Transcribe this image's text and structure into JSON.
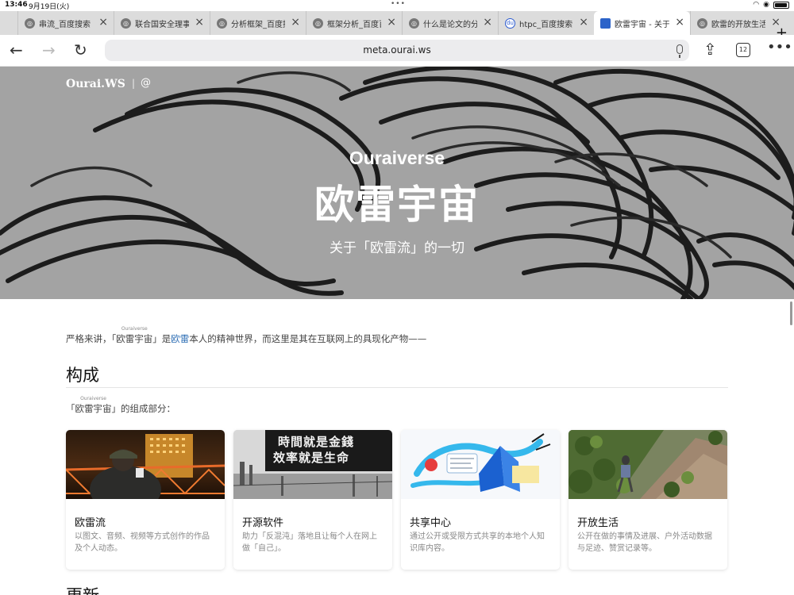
{
  "status": {
    "time": "13:46",
    "date": "9月19日(火)"
  },
  "tabs": [
    {
      "label": "串流_百度搜索",
      "icon": "globe-icon"
    },
    {
      "label": "联合国安全理事会",
      "icon": "globe-icon"
    },
    {
      "label": "分析框架_百度搜索",
      "icon": "globe-icon"
    },
    {
      "label": "框架分析_百度百科",
      "icon": "globe-icon"
    },
    {
      "label": "什么是论文的分析",
      "icon": "globe-icon"
    },
    {
      "label": "htpc_百度搜索",
      "icon": "baidu-icon"
    },
    {
      "label": "欧雷宇宙 - 关于",
      "icon": "ourai-icon",
      "active": true
    },
    {
      "label": "欧雷的开放生活",
      "icon": "globe-icon"
    }
  ],
  "toolbar": {
    "url": "meta.ourai.ws",
    "tab_count": "12"
  },
  "hero": {
    "brand": "Ourai.WS",
    "separator": "|",
    "at": "@",
    "subtitle": "Ouraiverse",
    "title": "欧雷宇宙",
    "tagline": "关于「欧雷流」的一切"
  },
  "intro": {
    "prefix": "严格来讲，「",
    "ruby_base": "欧雷宇宙",
    "ruby_text": "Ouraiverse",
    "mid": "」是",
    "link": "欧雷",
    "suffix": "本人的精神世界，而这里是其在互联网上的具现化产物——"
  },
  "composition": {
    "heading": "构成",
    "prefix": "「",
    "ruby_base": "欧雷宇宙",
    "ruby_text": "Ouraiverse",
    "suffix": "」的组成部分："
  },
  "cards": [
    {
      "title": "欧雷流",
      "desc": "以图文、音频、视频等方式创作的作品及个人动态。"
    },
    {
      "title": "开源软件",
      "desc": "助力「反混沌」落地且让每个人在网上做「自己」。",
      "image_text": [
        "時間就是金錢",
        "效率就是生命"
      ]
    },
    {
      "title": "共享中心",
      "desc": "通过公开或受限方式共享的本地个人知识库内容。"
    },
    {
      "title": "开放生活",
      "desc": "公开在做的事情及进展、户外活动数据与足迹、赞赏记录等。"
    }
  ],
  "next_heading": "更新"
}
